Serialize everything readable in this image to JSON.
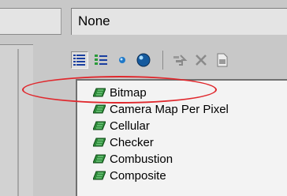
{
  "material": {
    "name_value": "None"
  },
  "toolbar": {
    "buttons": [
      {
        "icon": "list-view-icon",
        "pressed": true
      },
      {
        "icon": "list-icons-view-icon",
        "pressed": false
      },
      {
        "icon": "small-icons-view-icon",
        "pressed": false
      },
      {
        "icon": "large-icons-view-icon",
        "pressed": false
      },
      {
        "icon": "update-scene-materials-icon",
        "pressed": false
      },
      {
        "icon": "delete-icon",
        "pressed": false
      },
      {
        "icon": "clear-material-library-icon",
        "pressed": false
      }
    ]
  },
  "browser_list": {
    "items": [
      {
        "label": "Bitmap",
        "highlighted": true
      },
      {
        "label": "Camera Map Per Pixel"
      },
      {
        "label": "Cellular"
      },
      {
        "label": "Checker"
      },
      {
        "label": "Combustion"
      },
      {
        "label": "Composite"
      }
    ]
  },
  "annotation": {
    "color": "#e0282d"
  }
}
